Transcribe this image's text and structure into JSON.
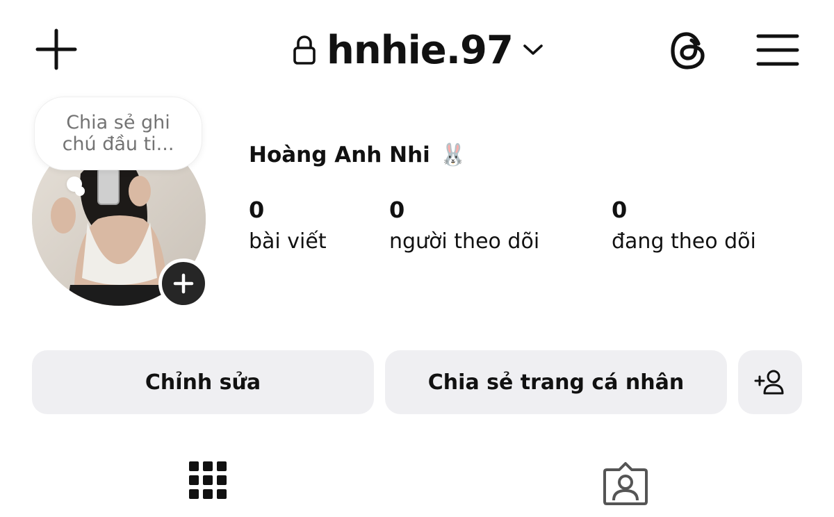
{
  "header": {
    "new_post_icon": "plus-icon",
    "username": "hnhie.97",
    "lock_icon": "lock-icon",
    "dropdown_icon": "chevron-down-icon",
    "threads_icon": "threads-icon",
    "menu_icon": "hamburger-menu-icon"
  },
  "profile": {
    "note_placeholder": "Chia sẻ ghi\nchú đầu ti...",
    "full_name": "Hoàng Anh Nhi",
    "full_name_emoji": "🐰",
    "add_story_icon": "plus-icon",
    "stats": [
      {
        "value": "0",
        "label": "bài viết"
      },
      {
        "value": "0",
        "label": "người theo dõi"
      },
      {
        "value": "0",
        "label": "đang theo dõi"
      }
    ]
  },
  "actions": {
    "edit_label": "Chỉnh sửa",
    "share_label": "Chia sẻ trang cá nhân",
    "discover_icon": "add-person-icon"
  },
  "tabs": [
    {
      "name": "posts",
      "icon": "grid-icon"
    },
    {
      "name": "tagged",
      "icon": "tagged-person-icon"
    }
  ],
  "colors": {
    "text": "#111111",
    "muted": "#737373",
    "button_bg": "#efeff2",
    "add_story_bg": "#262626"
  }
}
